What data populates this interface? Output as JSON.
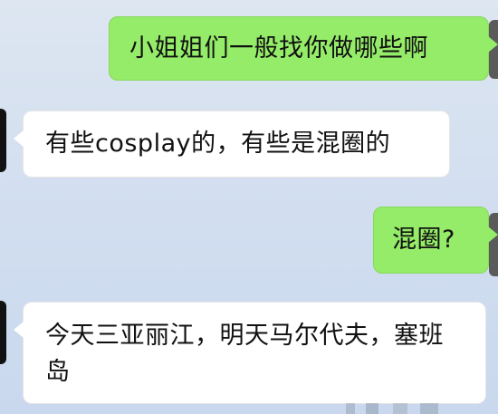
{
  "chat": {
    "messages": [
      {
        "side": "me",
        "text": "小姐姐们一般找你做哪些啊"
      },
      {
        "side": "them",
        "text": "有些cosplay的，有些是混圈的"
      },
      {
        "side": "me",
        "text": "混圈?"
      },
      {
        "side": "them",
        "text": "今天三亚丽江，明天马尔代夫，塞班岛"
      }
    ]
  },
  "colors": {
    "me_bubble": "#95ec69",
    "them_bubble": "#ffffff",
    "background": "#d3dff0"
  }
}
